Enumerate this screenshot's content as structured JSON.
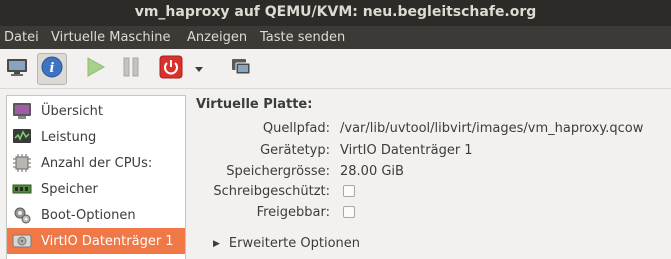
{
  "window": {
    "title": "vm_haproxy auf QEMU/KVM: neu.begleitschafe.org"
  },
  "menu": {
    "items": [
      "Datei",
      "Virtuelle Maschine",
      "Anzeigen",
      "Taste senden"
    ]
  },
  "toolbar": {
    "buttons": [
      "monitor-icon",
      "info-icon",
      "play-icon",
      "pause-icon",
      "power-icon",
      "dropdown-arrow-icon",
      "screenshot-icon"
    ],
    "active": "info-icon"
  },
  "sidebar": {
    "items": [
      {
        "label": "Übersicht",
        "icon": "overview-icon"
      },
      {
        "label": "Leistung",
        "icon": "performance-icon"
      },
      {
        "label": "Anzahl der CPUs:",
        "icon": "cpu-icon"
      },
      {
        "label": "Speicher",
        "icon": "memory-icon"
      },
      {
        "label": "Boot-Optionen",
        "icon": "boot-options-icon"
      },
      {
        "label": "VirtIO Datenträger 1",
        "icon": "disk-icon"
      }
    ],
    "selected_index": 5
  },
  "details": {
    "heading": "Virtuelle Platte:",
    "source_path_label": "Quellpfad:",
    "source_path_value": "/var/lib/uvtool/libvirt/images/vm_haproxy.qcow",
    "device_type_label": "Gerätetyp:",
    "device_type_value": "VirtIO Datenträger 1",
    "storage_size_label": "Speichergrösse:",
    "storage_size_value": "28.00 GiB",
    "readonly_label": "Schreibgeschützt:",
    "readonly_checked": false,
    "shareable_label": "Freigebbar:",
    "shareable_checked": false,
    "advanced_label": "Erweiterte Optionen"
  },
  "colors": {
    "selection": "#f07746",
    "titlebar": "#2c2b28",
    "menubar": "#3b3a36"
  }
}
